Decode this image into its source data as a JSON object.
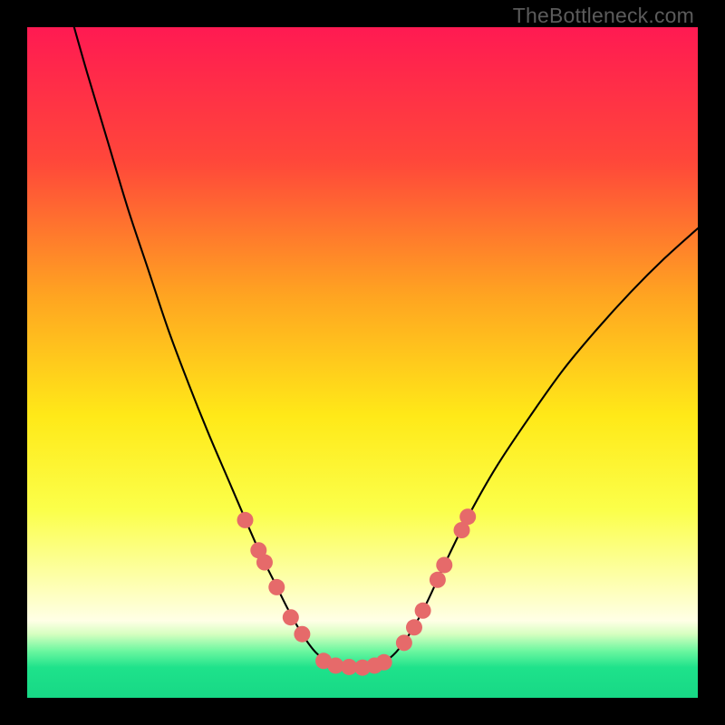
{
  "watermark": "TheBottleneck.com",
  "chart_data": {
    "type": "line",
    "title": "",
    "xlabel": "",
    "ylabel": "",
    "xlim": [
      0,
      100
    ],
    "ylim": [
      0,
      100
    ],
    "background_gradient": {
      "stops": [
        {
          "offset": 0.0,
          "color": "#ff1a52"
        },
        {
          "offset": 0.2,
          "color": "#ff473a"
        },
        {
          "offset": 0.4,
          "color": "#ffa421"
        },
        {
          "offset": 0.58,
          "color": "#ffe918"
        },
        {
          "offset": 0.72,
          "color": "#fbff4a"
        },
        {
          "offset": 0.82,
          "color": "#fdffa8"
        },
        {
          "offset": 0.885,
          "color": "#ffffe6"
        },
        {
          "offset": 0.905,
          "color": "#d6ffc0"
        },
        {
          "offset": 0.93,
          "color": "#6cf7a0"
        },
        {
          "offset": 0.955,
          "color": "#1ee28b"
        },
        {
          "offset": 1.0,
          "color": "#17d885"
        }
      ]
    },
    "series": [
      {
        "name": "curve",
        "color": "#000000",
        "width": 2.1,
        "points": [
          {
            "x": 7.0,
            "y": 100.0
          },
          {
            "x": 9.0,
            "y": 93.0
          },
          {
            "x": 12.0,
            "y": 83.0
          },
          {
            "x": 15.0,
            "y": 73.0
          },
          {
            "x": 18.0,
            "y": 64.0
          },
          {
            "x": 21.0,
            "y": 55.0
          },
          {
            "x": 24.0,
            "y": 47.0
          },
          {
            "x": 27.0,
            "y": 39.5
          },
          {
            "x": 30.0,
            "y": 32.5
          },
          {
            "x": 33.0,
            "y": 25.5
          },
          {
            "x": 35.0,
            "y": 21.0
          },
          {
            "x": 37.0,
            "y": 17.0
          },
          {
            "x": 39.0,
            "y": 13.0
          },
          {
            "x": 41.0,
            "y": 9.5
          },
          {
            "x": 43.0,
            "y": 6.8
          },
          {
            "x": 45.0,
            "y": 5.3
          },
          {
            "x": 47.0,
            "y": 4.7
          },
          {
            "x": 49.0,
            "y": 4.5
          },
          {
            "x": 51.0,
            "y": 4.6
          },
          {
            "x": 53.0,
            "y": 5.2
          },
          {
            "x": 55.0,
            "y": 6.8
          },
          {
            "x": 57.0,
            "y": 9.5
          },
          {
            "x": 59.0,
            "y": 13.0
          },
          {
            "x": 61.0,
            "y": 17.2
          },
          {
            "x": 63.0,
            "y": 21.5
          },
          {
            "x": 66.0,
            "y": 27.5
          },
          {
            "x": 70.0,
            "y": 34.5
          },
          {
            "x": 75.0,
            "y": 42.0
          },
          {
            "x": 80.0,
            "y": 49.0
          },
          {
            "x": 85.0,
            "y": 55.0
          },
          {
            "x": 90.0,
            "y": 60.5
          },
          {
            "x": 95.0,
            "y": 65.5
          },
          {
            "x": 100.0,
            "y": 70.0
          }
        ]
      }
    ],
    "markers": {
      "color": "#e66a6a",
      "radius": 9,
      "points": [
        {
          "x": 32.5,
          "y": 26.5
        },
        {
          "x": 34.5,
          "y": 22.0
        },
        {
          "x": 35.4,
          "y": 20.2
        },
        {
          "x": 37.2,
          "y": 16.5
        },
        {
          "x": 39.3,
          "y": 12.0
        },
        {
          "x": 41.0,
          "y": 9.5
        },
        {
          "x": 44.2,
          "y": 5.5
        },
        {
          "x": 46.0,
          "y": 4.8
        },
        {
          "x": 48.0,
          "y": 4.6
        },
        {
          "x": 50.0,
          "y": 4.5
        },
        {
          "x": 51.8,
          "y": 4.8
        },
        {
          "x": 53.2,
          "y": 5.3
        },
        {
          "x": 56.2,
          "y": 8.2
        },
        {
          "x": 57.7,
          "y": 10.5
        },
        {
          "x": 59.0,
          "y": 13.0
        },
        {
          "x": 61.2,
          "y": 17.6
        },
        {
          "x": 62.2,
          "y": 19.8
        },
        {
          "x": 64.8,
          "y": 25.0
        },
        {
          "x": 65.7,
          "y": 27.0
        }
      ]
    }
  }
}
